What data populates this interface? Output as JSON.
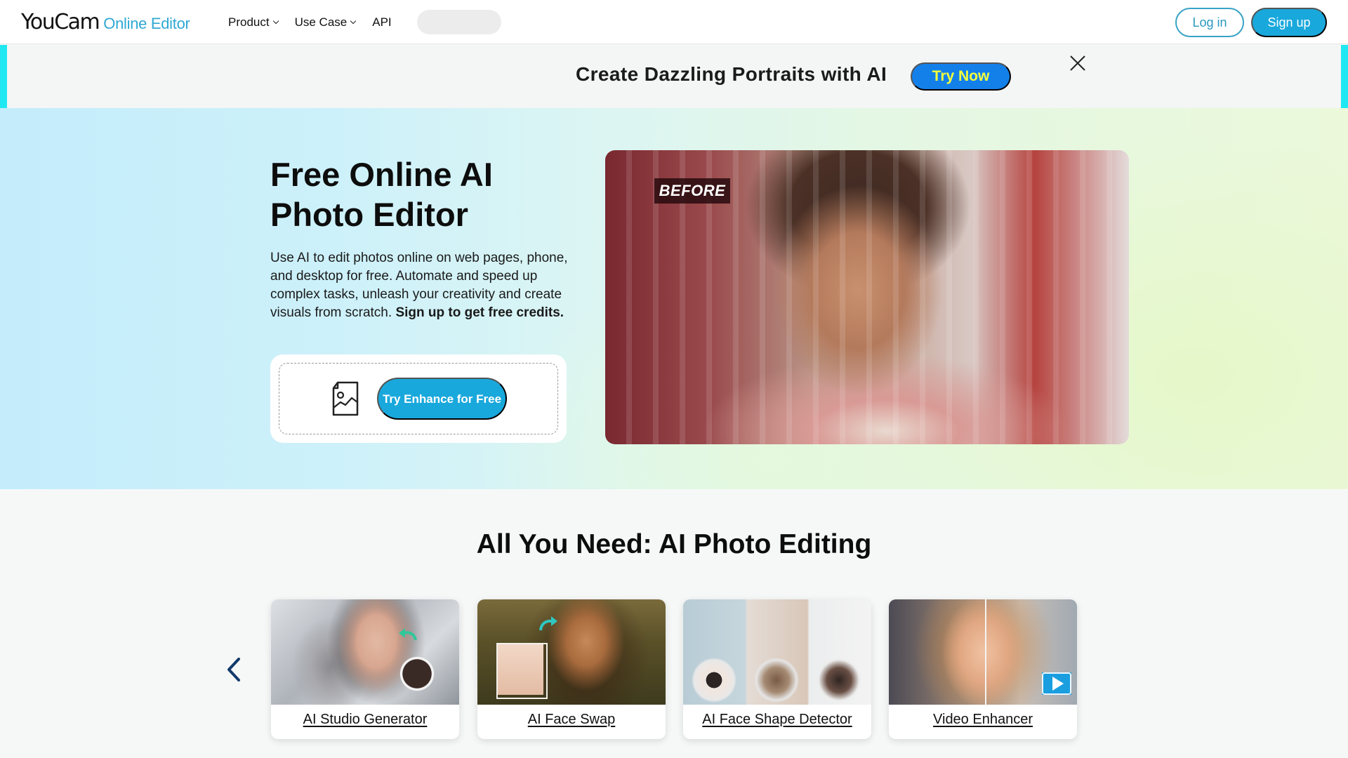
{
  "header": {
    "logo_main": "YouCam",
    "logo_sub": "Online Editor",
    "nav": [
      {
        "label": "Product",
        "has_dropdown": true
      },
      {
        "label": "Use Case",
        "has_dropdown": true
      },
      {
        "label": "API",
        "has_dropdown": false
      }
    ],
    "login_label": "Log in",
    "signup_label": "Sign up"
  },
  "banner": {
    "text": "Create Dazzling Portraits with AI",
    "cta_label": "Try Now",
    "close_icon": "close-icon"
  },
  "hero": {
    "title": "Free Online AI Photo Editor",
    "description": "Use AI to edit photos online on web pages, phone, and desktop for free. Automate and speed up complex tasks, unleash your creativity and create visuals from scratch.",
    "description_bold": "Sign up to get free credits.",
    "upload_icon": "image-file-icon",
    "enhance_button_label": "Try Enhance for Free",
    "image_tag": "BEFORE"
  },
  "features": {
    "title": "All You Need: AI Photo Editing",
    "prev_icon": "chevron-left-icon",
    "cards": [
      {
        "label": "AI Studio Generator"
      },
      {
        "label": "AI Face Swap"
      },
      {
        "label": "AI Face Shape Detector"
      },
      {
        "label": "Video Enhancer"
      }
    ]
  },
  "colors": {
    "brand_blue": "#19a8dc",
    "banner_cta_bg": "#1380ea",
    "banner_cta_text": "#f4ff3c",
    "banner_edge": "#1fe8f2",
    "logo_sub": "#2fa8d3"
  }
}
